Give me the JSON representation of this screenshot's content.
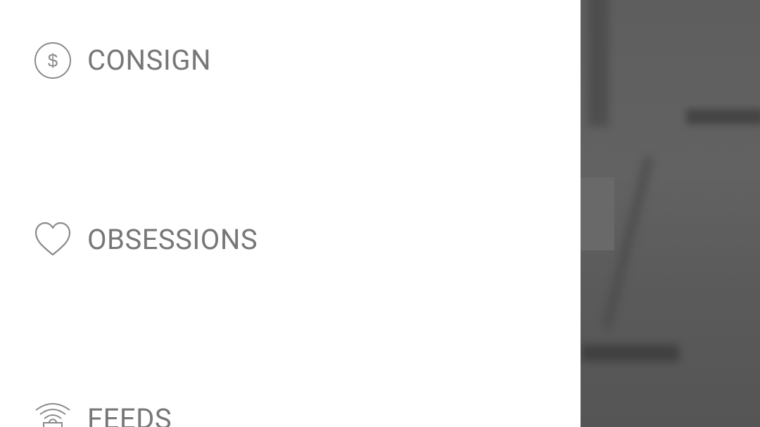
{
  "colors": {
    "drawer_background": "#ffffff",
    "menu_text": "#777777",
    "icon_stroke": "#8a8a8a",
    "backdrop": "#5e5e5e"
  },
  "menu": {
    "items": [
      {
        "label": "CONSIGN",
        "icon": "dollar-circle-icon"
      },
      {
        "label": "OBSESSIONS",
        "icon": "heart-icon"
      },
      {
        "label": "FEEDS",
        "icon": "shopping-bag-signal-icon"
      }
    ]
  }
}
